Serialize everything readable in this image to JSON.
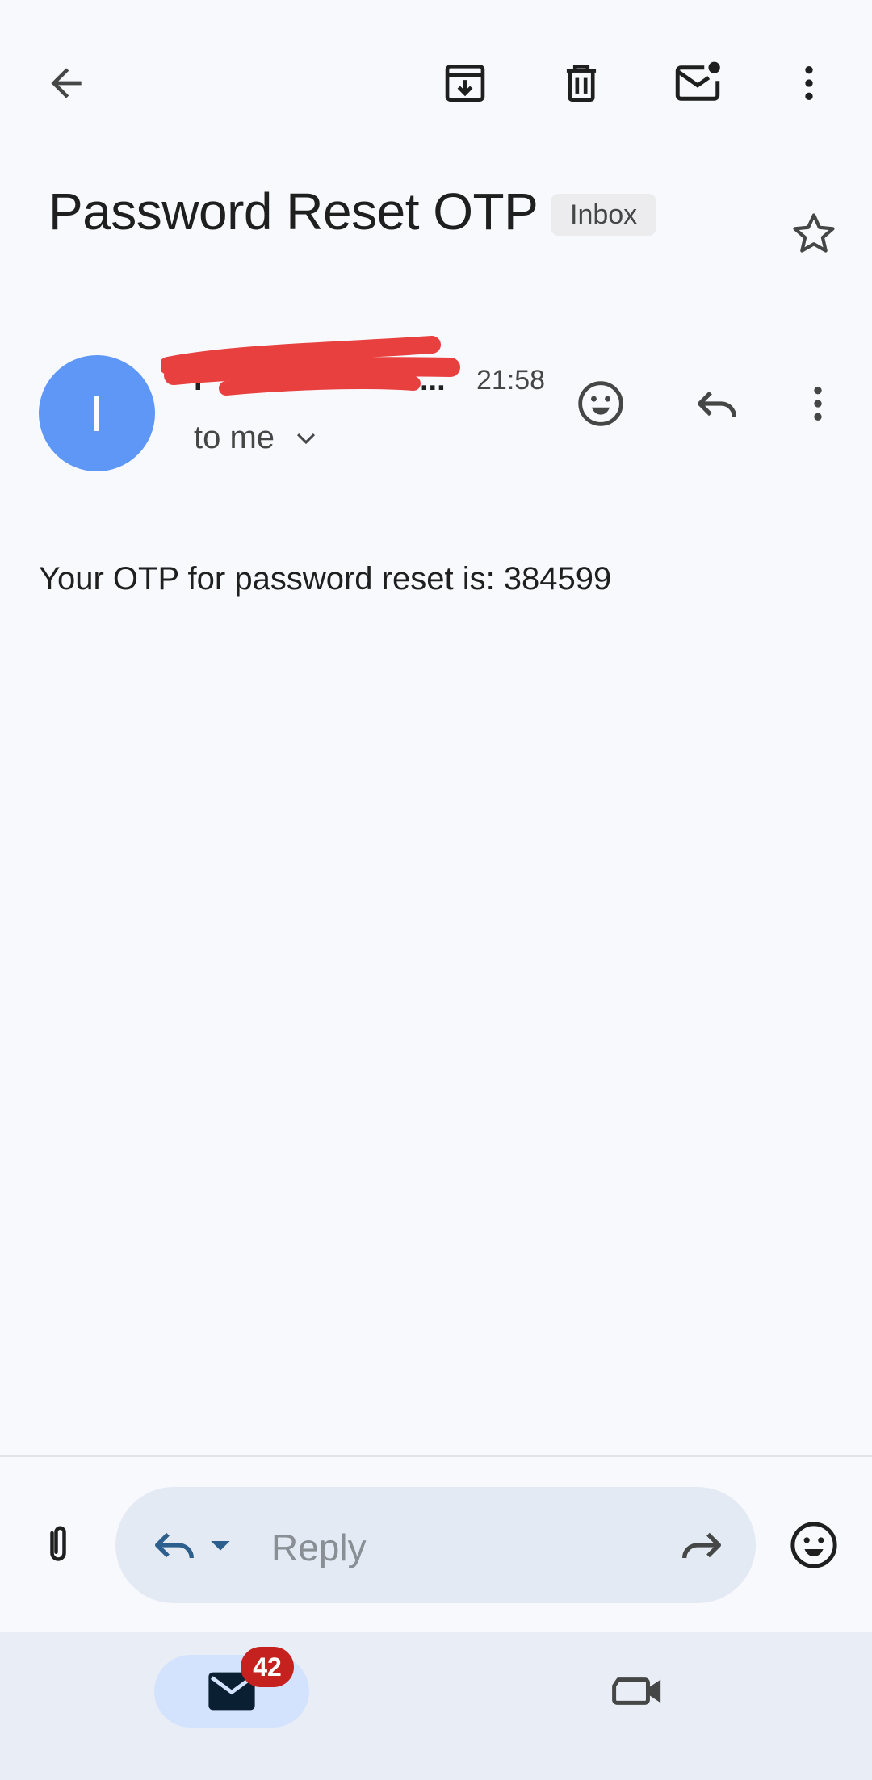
{
  "toolbar": {
    "back_icon": "arrow-back-icon",
    "archive_icon": "archive-icon",
    "delete_icon": "trash-icon",
    "mark_unread_icon": "mail-unread-icon",
    "more_icon": "more-vertical-icon"
  },
  "email": {
    "subject": "Password Reset OTP",
    "label": "Inbox",
    "starred": false,
    "sender": {
      "avatar_initial": "I",
      "avatar_color": "#5e97f6",
      "name_visible": "I",
      "name_redacted": true,
      "ellipsis": "...",
      "time": "21:58"
    },
    "recipient": "to me",
    "body": "Your OTP for password reset is: 384599"
  },
  "reply_bar": {
    "placeholder": "Reply"
  },
  "bottom_nav": {
    "mail_badge": "42",
    "active": "mail"
  },
  "colors": {
    "background": "#f8f9fd",
    "accent_blue": "#5e97f6",
    "badge_red": "#c5221f",
    "redaction_red": "#e8403f"
  }
}
